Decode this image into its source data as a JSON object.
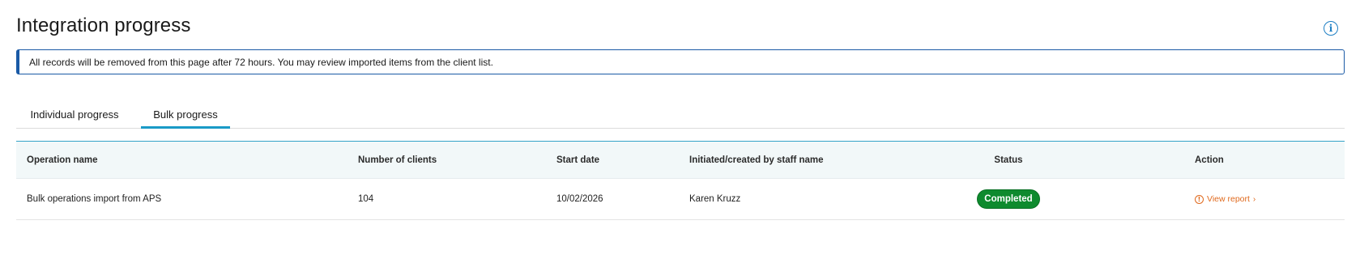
{
  "page": {
    "title": "Integration progress",
    "info_icon": "info-circle-icon"
  },
  "notice": {
    "text": "All records will be removed from this page after 72 hours. You may review imported items from the client list."
  },
  "tabs": [
    {
      "label": "Individual progress",
      "active": false
    },
    {
      "label": "Bulk progress",
      "active": true
    }
  ],
  "table": {
    "columns": [
      "Operation name",
      "Number of clients",
      "Start date",
      "Initiated/created by staff name",
      "Status",
      "Action"
    ],
    "rows": [
      {
        "operation_name": "Bulk operations import from APS",
        "number_of_clients": "104",
        "start_date": "10/02/2026",
        "staff_name": "Karen Kruzz",
        "status": "Completed",
        "action_label": "View report",
        "action_icon": "alert-circle-icon"
      }
    ]
  },
  "colors": {
    "accent": "#1a9ac7",
    "notice_border": "#1a5aa6",
    "status_completed": "#0e8a2e",
    "action_link": "#e06a1e"
  }
}
